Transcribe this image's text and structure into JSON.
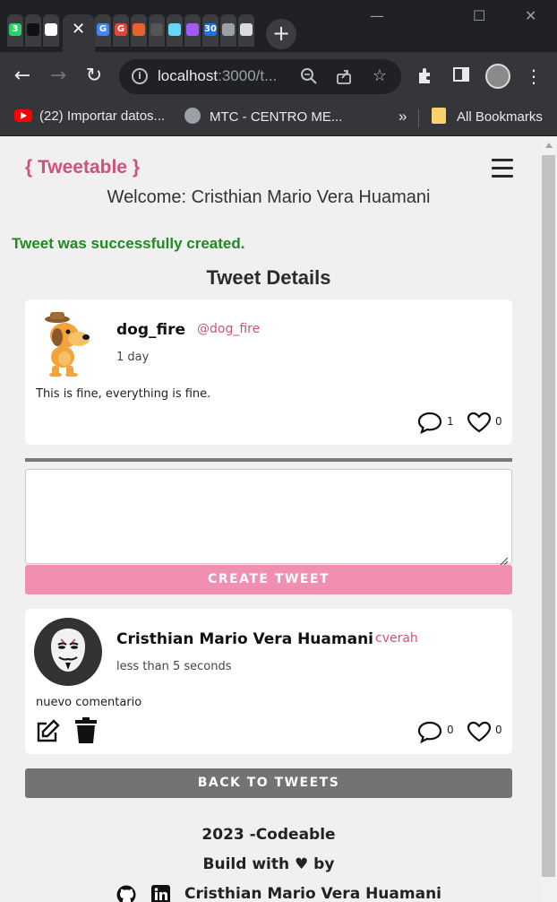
{
  "browser": {
    "tabs": [
      {
        "icon": "whatsapp-icon",
        "glyph": "3",
        "color": "#25d366"
      },
      {
        "icon": "app-icon",
        "glyph": "",
        "color": "#111111"
      },
      {
        "icon": "github-icon",
        "glyph": "",
        "color": "#ffffff"
      },
      {
        "icon": "google-translate-icon",
        "glyph": "G",
        "color": "#4285f4"
      },
      {
        "icon": "google-icon",
        "glyph": "G",
        "color": "#ea4335"
      },
      {
        "icon": "codeable-icon",
        "glyph": "",
        "color": "#e8622c"
      },
      {
        "icon": "code-icon",
        "glyph": "",
        "color": "#555555"
      },
      {
        "icon": "react-icon",
        "glyph": "",
        "color": "#61dafb"
      },
      {
        "icon": "figma-icon",
        "glyph": "",
        "color": "#a259ff"
      },
      {
        "icon": "calendar-icon",
        "glyph": "30",
        "color": "#1a73e8"
      },
      {
        "icon": "chrome-icon",
        "glyph": "",
        "color": "#9aa0a6"
      },
      {
        "icon": "chrome-icon",
        "glyph": "",
        "color": "#dadce0"
      }
    ],
    "active_tab_close": "✕",
    "new_tab": "+",
    "window_controls": {
      "minimize": "—",
      "maximize": "☐",
      "close": "✕"
    },
    "url_host": "localhost",
    "url_rest": ":3000/t...",
    "bookmarks": [
      {
        "label": "(22) Importar datos..."
      },
      {
        "label": "MTC - CENTRO ME..."
      }
    ],
    "bookmarks_overflow": "»",
    "all_bookmarks": "All Bookmarks"
  },
  "header": {
    "brand": "{ Tweetable }",
    "welcome": "Welcome: Cristhian Mario Vera Huamani"
  },
  "flash": "Tweet was successfully created.",
  "section_title": "Tweet Details",
  "tweet": {
    "author": "dog_fire",
    "handle": "@dog_fire",
    "time": "1 day",
    "body": "This is fine, everything is fine.",
    "replies": "1",
    "likes": "0"
  },
  "composer": {
    "placeholder": "",
    "submit_label": "CREATE TWEET"
  },
  "reply": {
    "author": "Cristhian Mario Vera Huamani",
    "handle": "cverah",
    "time": "less than 5 seconds",
    "body": "nuevo comentario",
    "replies": "0",
    "likes": "0"
  },
  "back_label": "BACK TO TWEETS",
  "footer": {
    "year": "2023 -Codeable",
    "build": "Build with ♥ by",
    "author": "Cristhian Mario Vera Huamani"
  }
}
